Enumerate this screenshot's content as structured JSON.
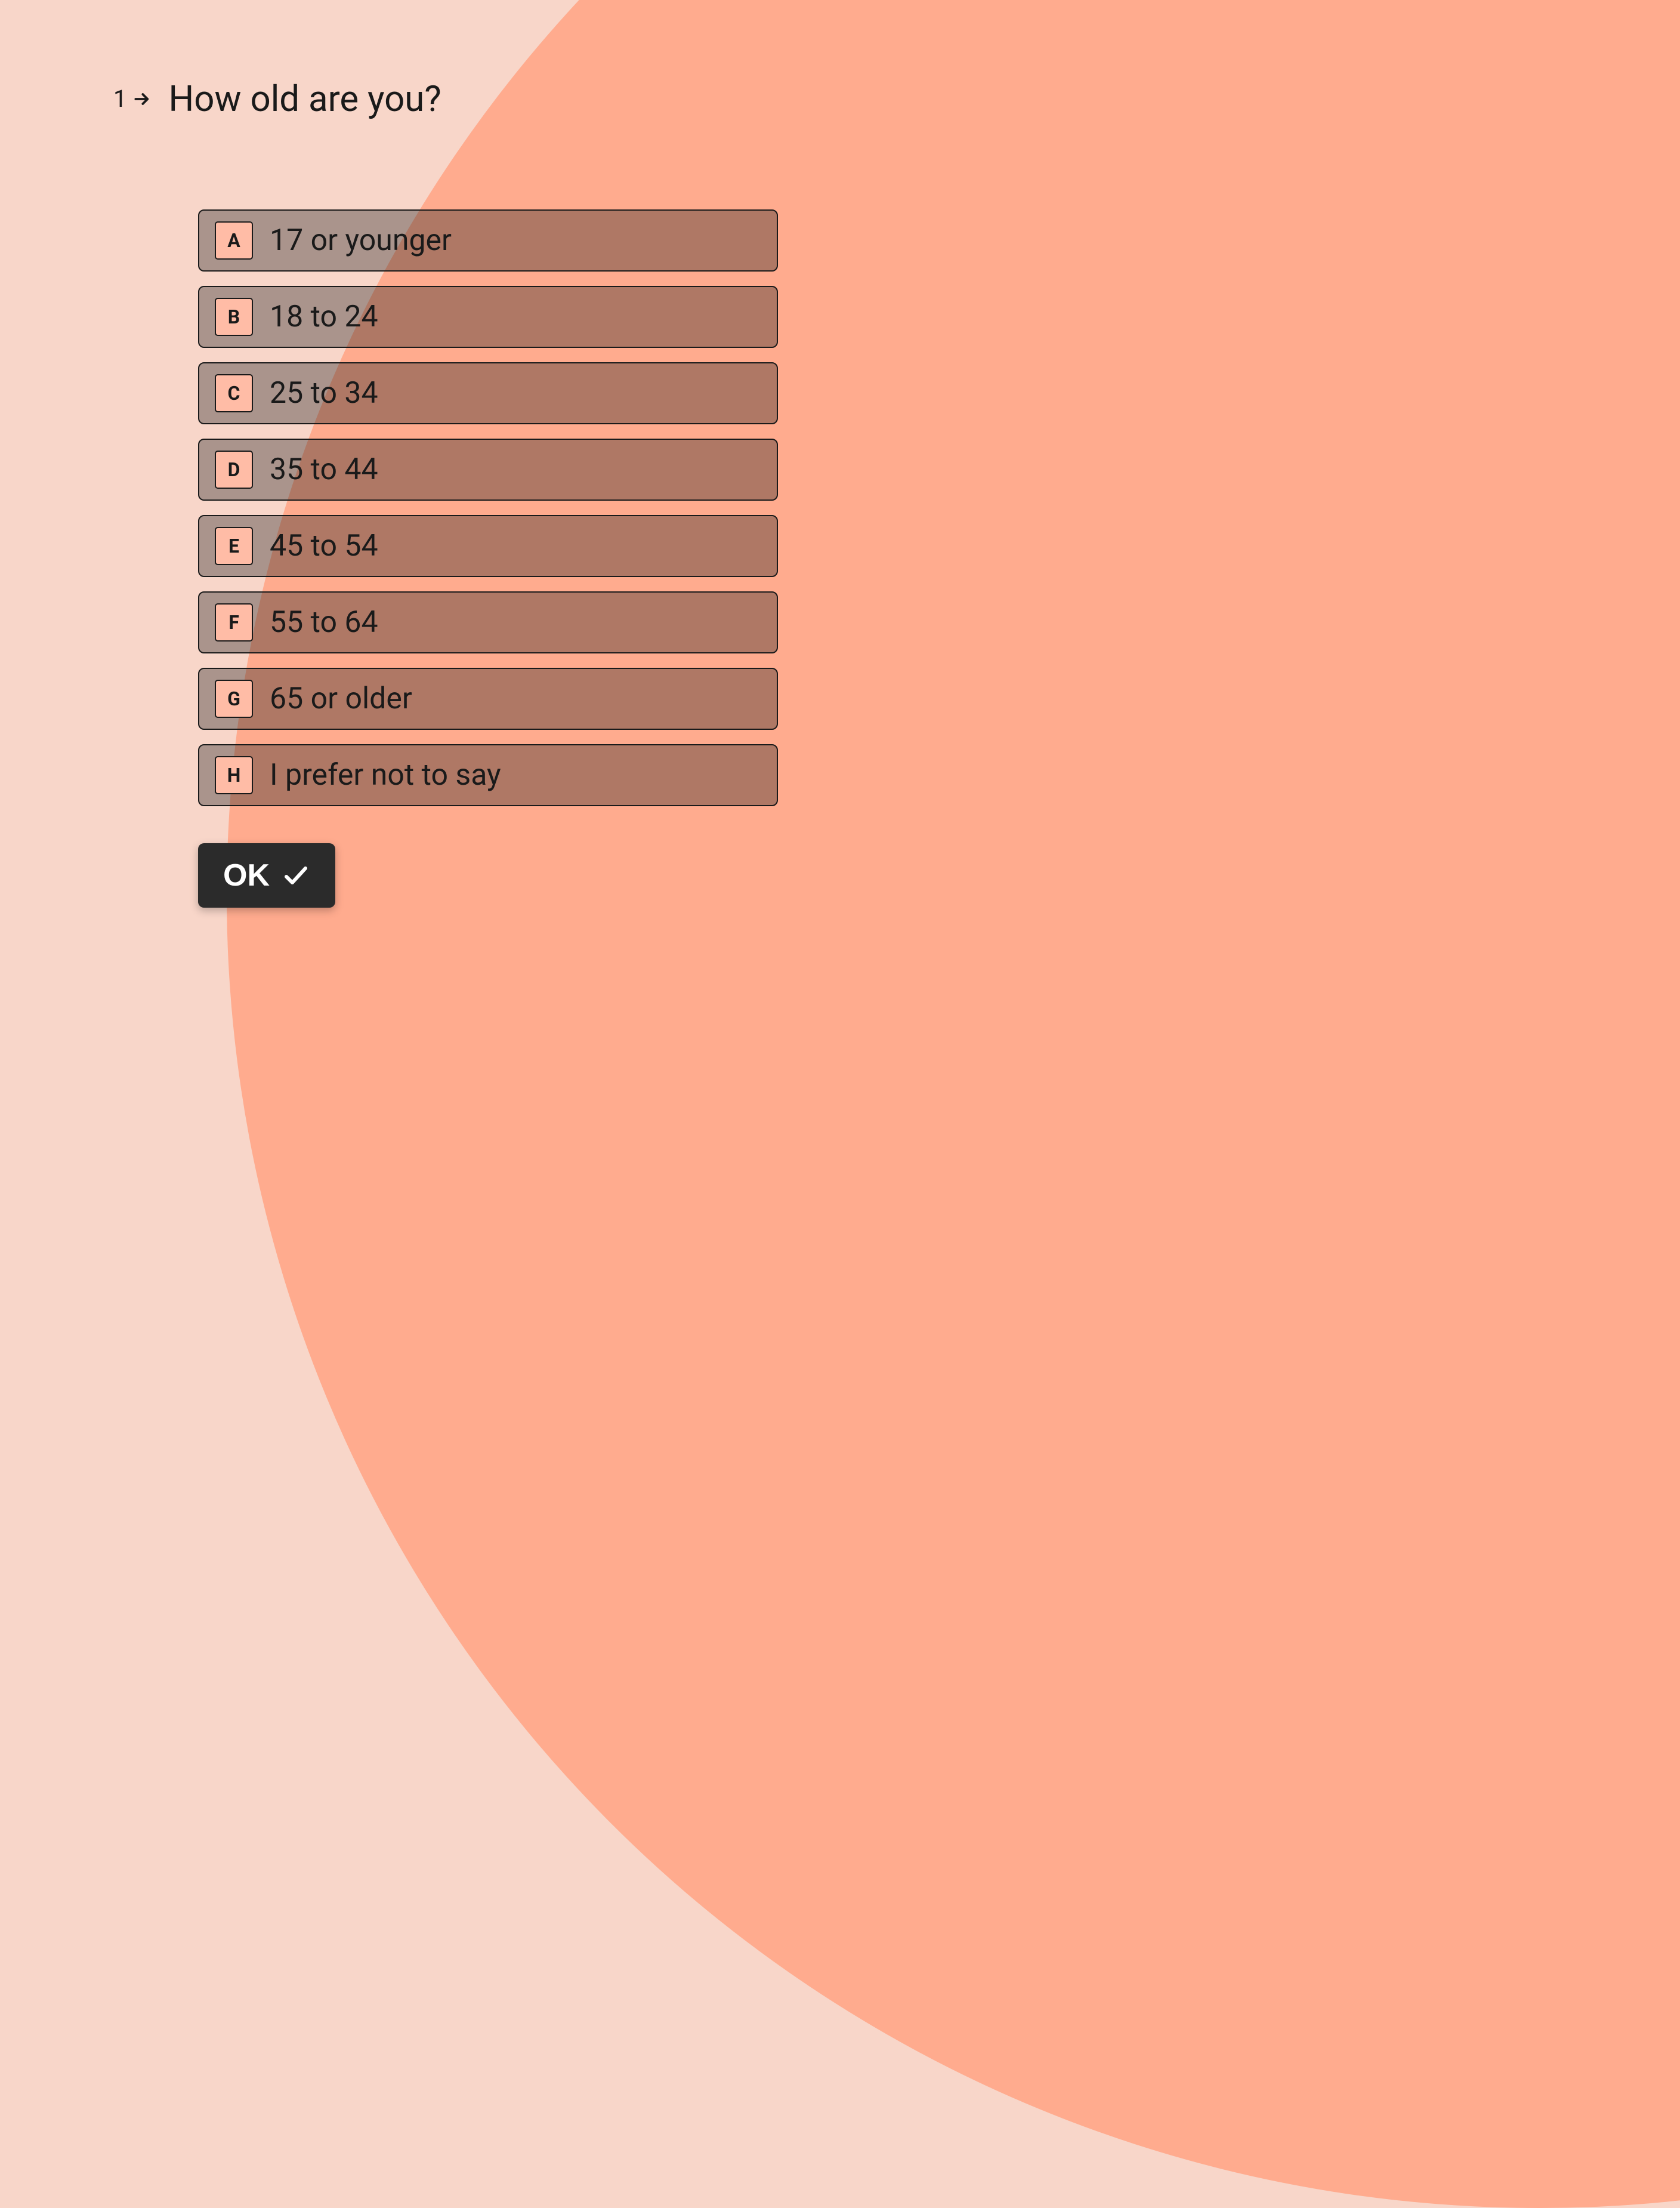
{
  "question": {
    "number": "1",
    "text": "How old are you?"
  },
  "options": [
    {
      "key": "A",
      "label": "17 or younger"
    },
    {
      "key": "B",
      "label": "18 to 24"
    },
    {
      "key": "C",
      "label": "25 to 34"
    },
    {
      "key": "D",
      "label": "35 to 44"
    },
    {
      "key": "E",
      "label": "45 to 54"
    },
    {
      "key": "F",
      "label": "55 to 64"
    },
    {
      "key": "G",
      "label": "65 or older"
    },
    {
      "key": "H",
      "label": "I prefer not to say"
    }
  ],
  "ok_button": {
    "label": "OK"
  }
}
